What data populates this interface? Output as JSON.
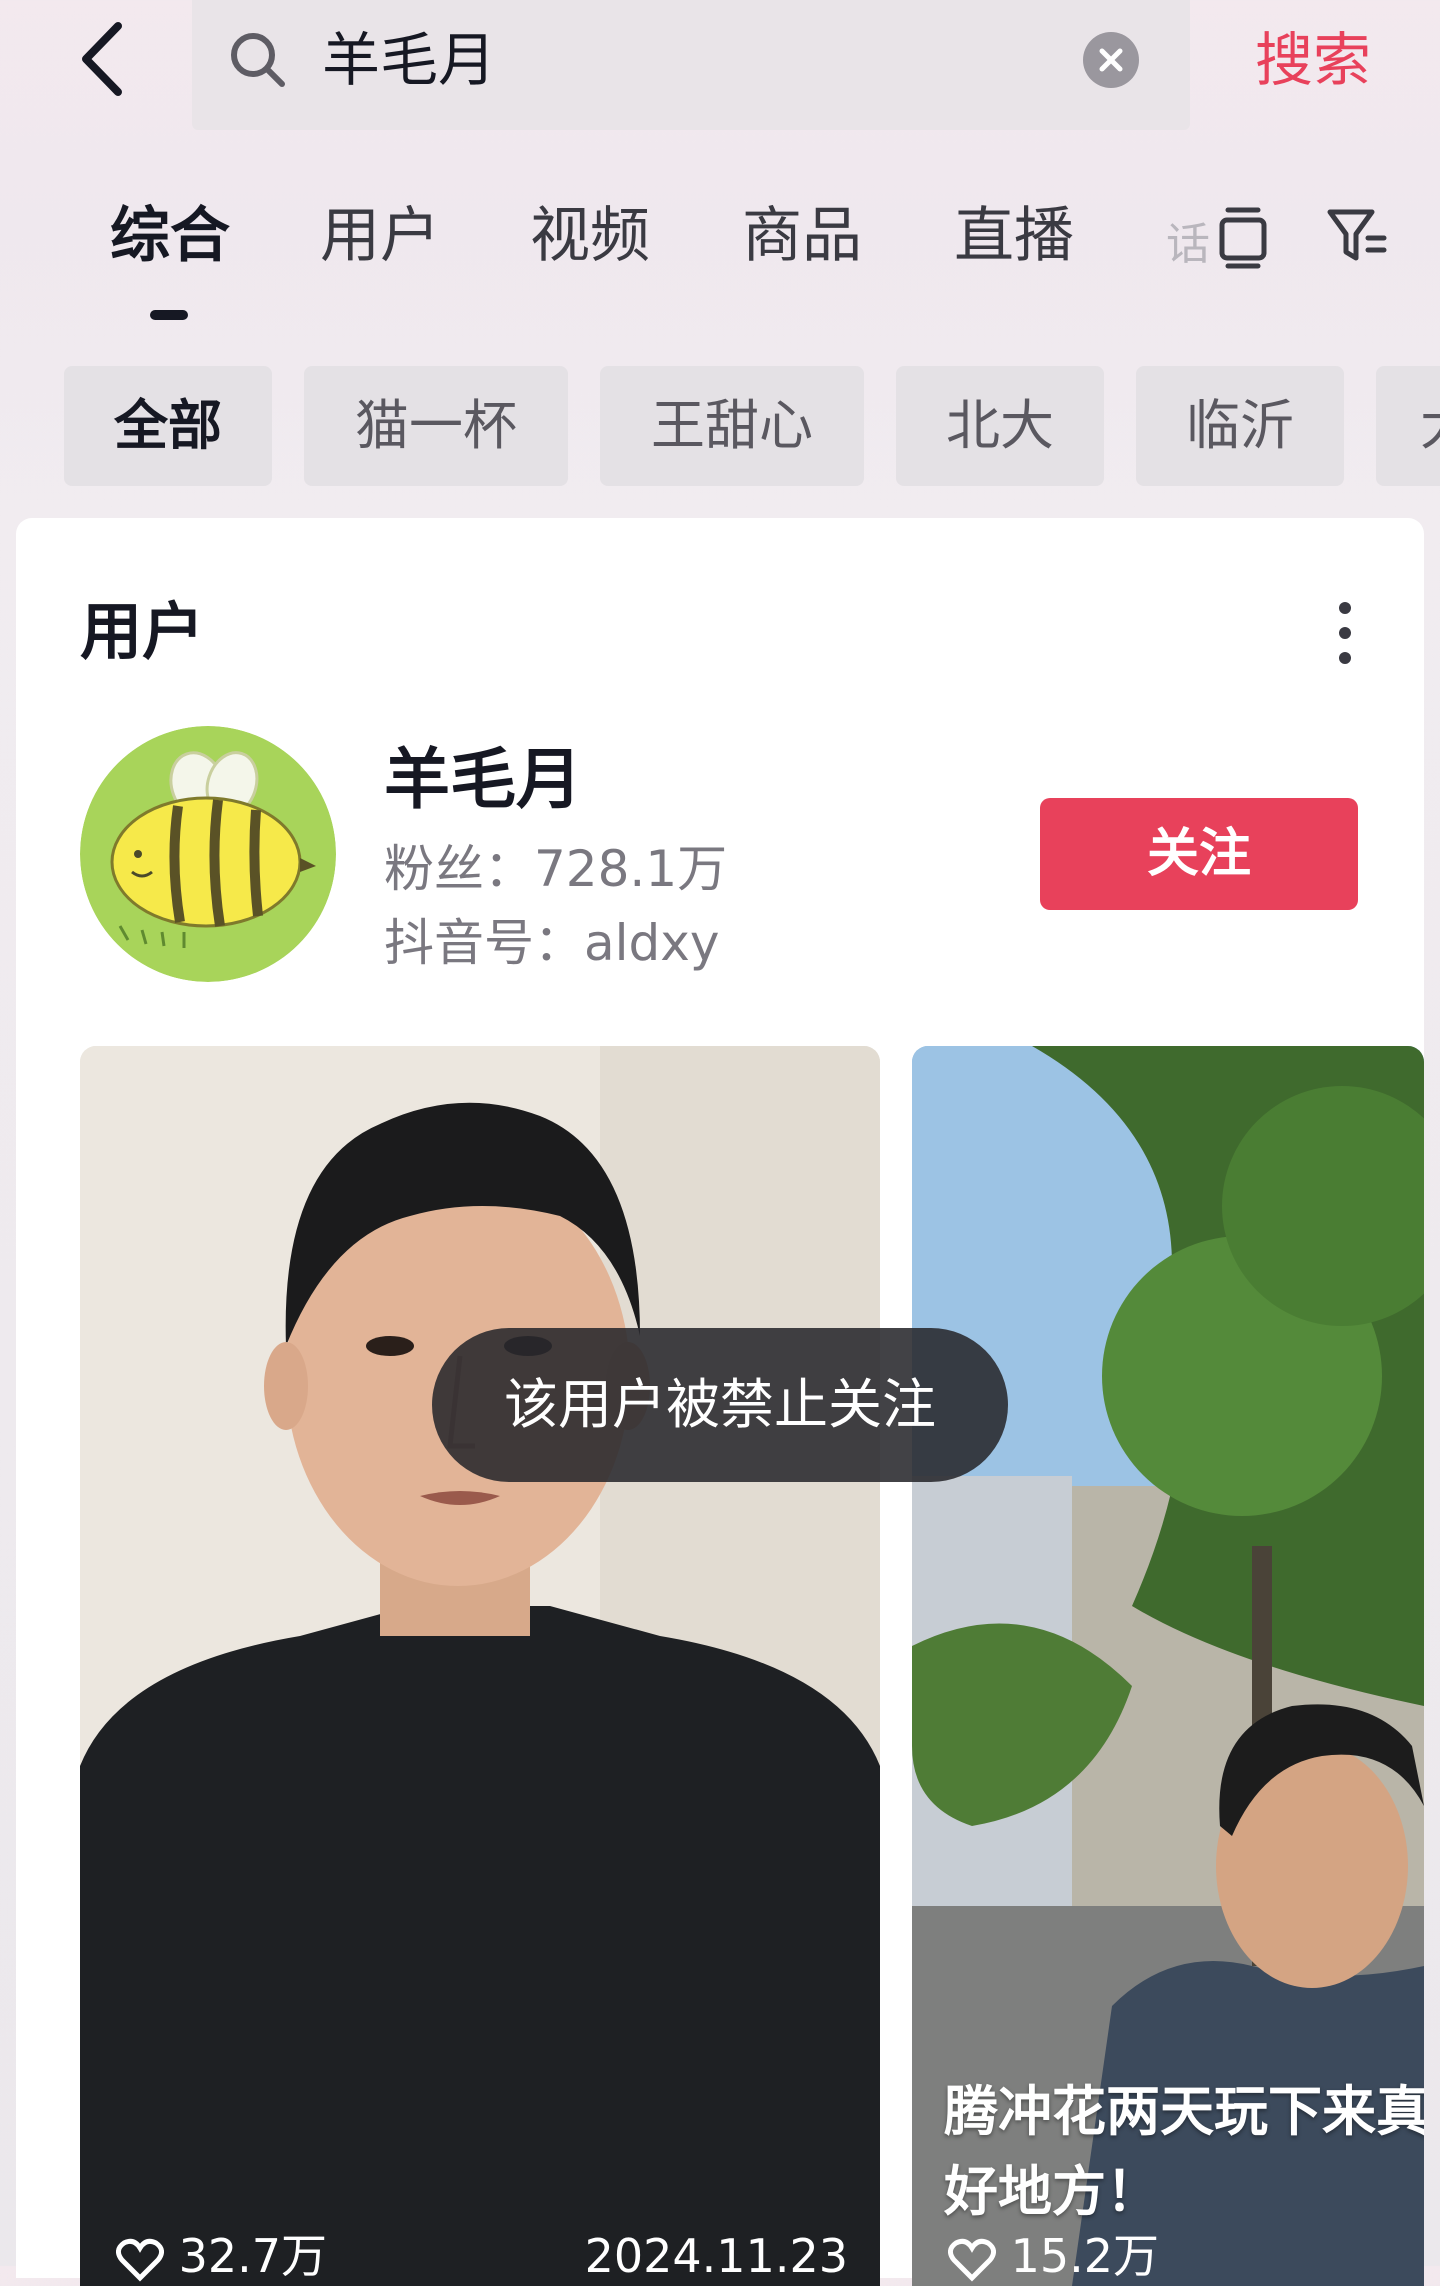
{
  "search": {
    "query": "羊毛月",
    "submit_label": "搜索"
  },
  "tabs": [
    {
      "label": "综合",
      "active": true
    },
    {
      "label": "用户"
    },
    {
      "label": "视频"
    },
    {
      "label": "商品"
    },
    {
      "label": "直播"
    },
    {
      "label": "话"
    }
  ],
  "chips": [
    {
      "label": "全部",
      "active": true
    },
    {
      "label": "猫一杯"
    },
    {
      "label": "王甜心"
    },
    {
      "label": "北大"
    },
    {
      "label": "临沂"
    },
    {
      "label": "大"
    }
  ],
  "user_section": {
    "title": "用户",
    "name": "羊毛月",
    "fans": "粉丝：728.1万",
    "douyin_id": "抖音号：aldxy",
    "follow_label": "关注"
  },
  "videos": [
    {
      "likes": "32.7万",
      "date": "2024.11.23"
    },
    {
      "likes": "15.2万",
      "caption_line1": "腾冲花两天玩下来真",
      "caption_line2": "好地方！"
    }
  ],
  "toast": "该用户被禁止关注",
  "colors": {
    "accent": "#e8415b",
    "text": "#161823",
    "secondary_text": "#7a7880"
  },
  "icons": [
    "back-icon",
    "search-icon",
    "clear-icon",
    "multi-column-icon",
    "filter-icon",
    "more-icon",
    "heart-icon"
  ]
}
